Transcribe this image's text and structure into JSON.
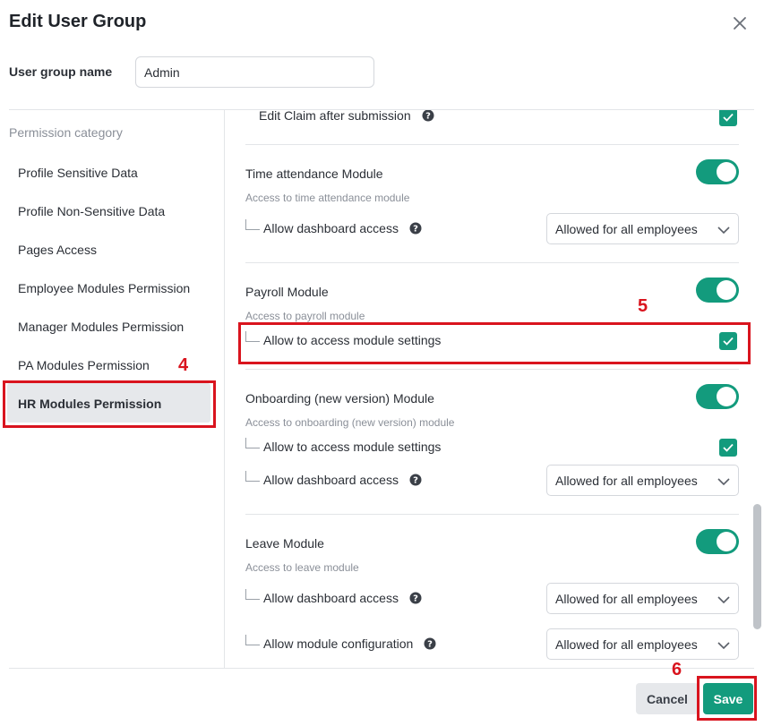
{
  "modal": {
    "title": "Edit User Group",
    "close_icon": "close-icon"
  },
  "group_name": {
    "label": "User group name",
    "value": "Admin"
  },
  "categories": {
    "heading": "Permission category",
    "items": [
      {
        "label": "Profile Sensitive Data"
      },
      {
        "label": "Profile Non-Sensitive Data"
      },
      {
        "label": "Pages Access"
      },
      {
        "label": "Employee Modules Permission"
      },
      {
        "label": "Manager Modules Permission"
      },
      {
        "label": "PA Modules Permission"
      },
      {
        "label": "HR Modules Permission",
        "active": true
      }
    ]
  },
  "modules": {
    "partial_row": {
      "label": "Edit Claim after submission",
      "checked": true
    },
    "time_attendance": {
      "title": "Time attendance Module",
      "description": "Access to time attendance module",
      "enabled": true,
      "permissions": [
        {
          "label": "Allow dashboard access",
          "help": true,
          "select": "Allowed for all employees"
        }
      ]
    },
    "payroll": {
      "title": "Payroll Module",
      "description": "Access to payroll module",
      "enabled": true,
      "permissions": [
        {
          "label": "Allow to access module settings",
          "checked": true
        }
      ]
    },
    "onboarding": {
      "title": "Onboarding (new version) Module",
      "description": "Access to onboarding (new version) module",
      "enabled": true,
      "permissions": [
        {
          "label": "Allow to access module settings",
          "checked": true
        },
        {
          "label": "Allow dashboard access",
          "help": true,
          "select": "Allowed for all employees"
        }
      ]
    },
    "leave": {
      "title": "Leave Module",
      "description": "Access to leave module",
      "enabled": true,
      "permissions": [
        {
          "label": "Allow dashboard access",
          "help": true,
          "select": "Allowed for all employees"
        },
        {
          "label": "Allow module configuration",
          "help": true,
          "select": "Allowed for all employees"
        }
      ]
    }
  },
  "annotations": {
    "step4": "4",
    "step5": "5",
    "step6": "6",
    "color": "#d9141e"
  },
  "footer": {
    "cancel_label": "Cancel",
    "save_label": "Save"
  },
  "colors": {
    "accent": "#139b7d",
    "active_bg": "#e6e8eb"
  }
}
